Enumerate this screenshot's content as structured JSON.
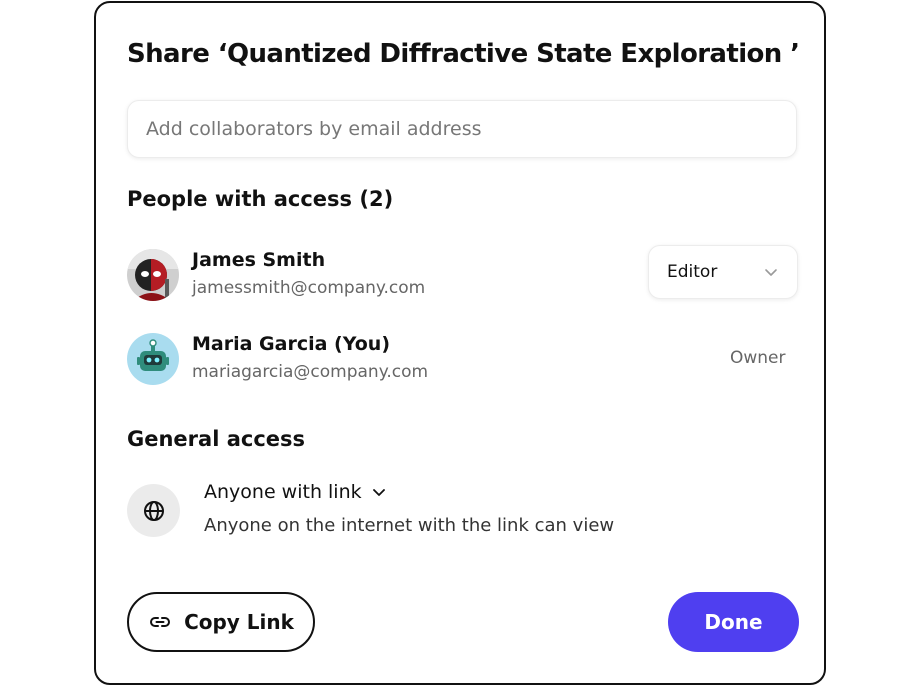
{
  "dialog": {
    "title": "Share ‘Quantized Diffractive State Exploration ’",
    "email_input": {
      "placeholder": "Add collaborators by email address",
      "value": ""
    },
    "people_section": {
      "heading": "People with access (2)",
      "people": [
        {
          "name": "James Smith",
          "email": "jamessmith@company.com",
          "role": "Editor",
          "role_editable": true,
          "avatar_icon": "deadpool-avatar"
        },
        {
          "name": "Maria Garcia (You)",
          "email": "mariagarcia@company.com",
          "role": "Owner",
          "role_editable": false,
          "avatar_icon": "robot-avatar"
        }
      ]
    },
    "general_access": {
      "heading": "General access",
      "icon": "globe-icon",
      "option_label": "Anyone with link",
      "description": "Anyone on the internet with the link can view"
    },
    "footer": {
      "copy_link_label": "Copy Link",
      "copy_link_icon": "link-icon",
      "done_label": "Done"
    }
  },
  "colors": {
    "accent": "#4f3ff0",
    "text_primary": "#111111",
    "text_secondary": "#666666",
    "border": "#ececec",
    "icon_background": "#ebebeb"
  }
}
